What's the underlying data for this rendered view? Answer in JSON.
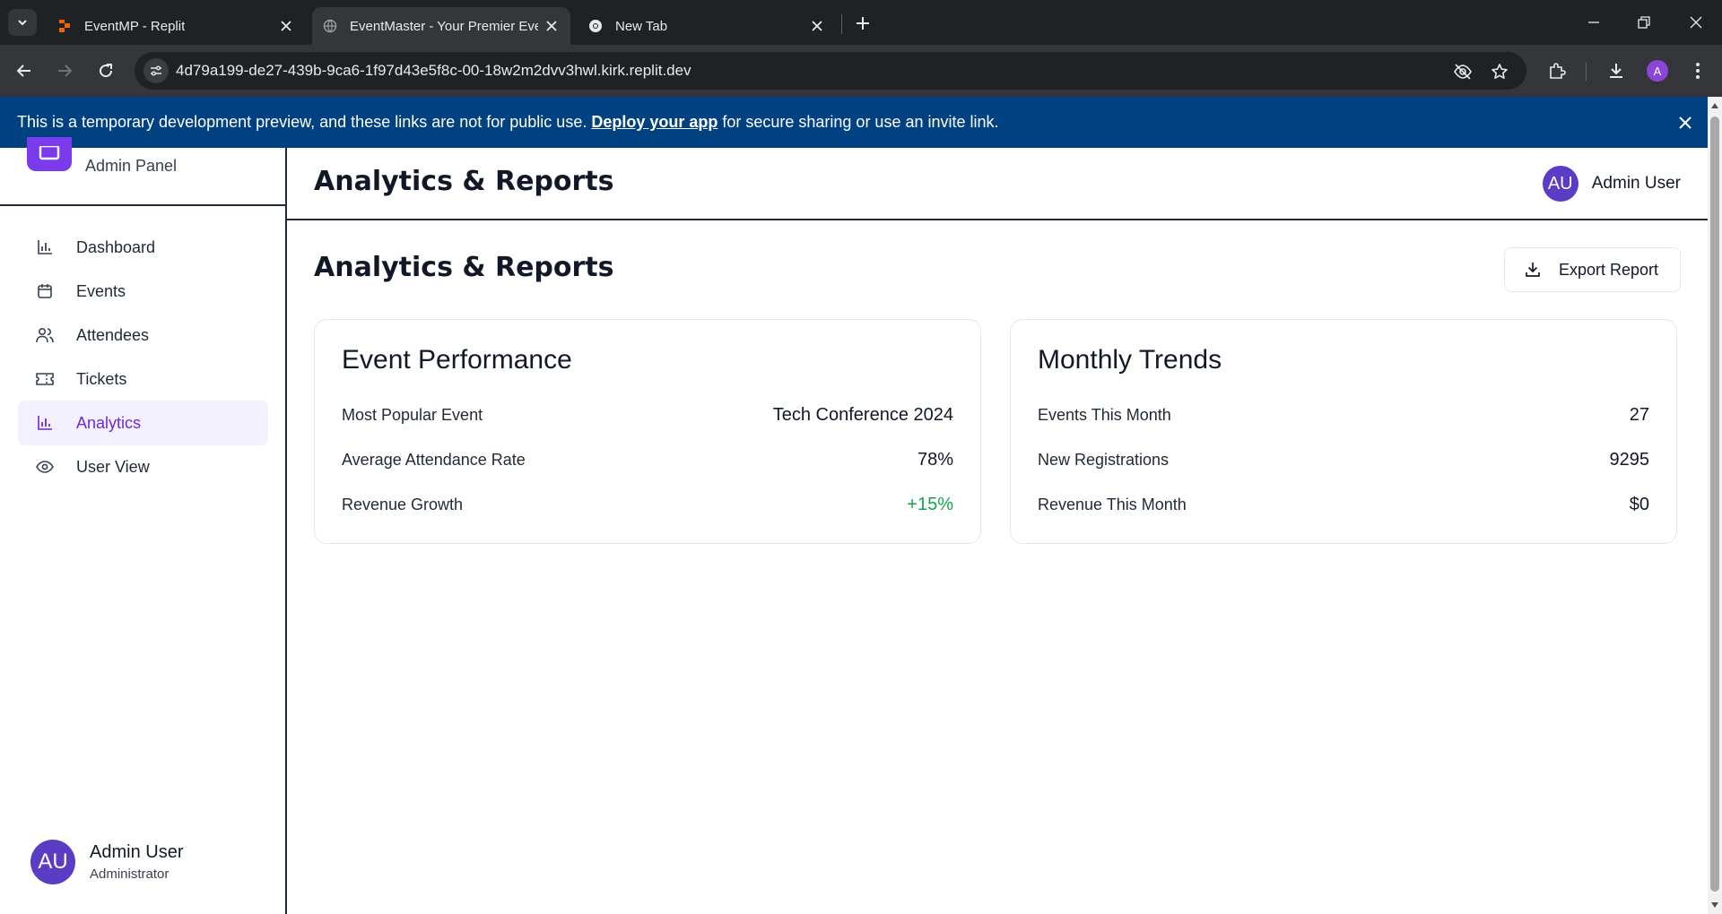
{
  "browser": {
    "tabs": [
      {
        "title": "EventMP - Replit",
        "active": false
      },
      {
        "title": "EventMaster - Your Premier Eve",
        "active": true
      },
      {
        "title": "New Tab",
        "active": false
      }
    ],
    "url": "4d79a199-de27-439b-9ca6-1f97d43e5f8c-00-18w2m2dvv3hwl.kirk.replit.dev",
    "profile_initial": "A"
  },
  "banner": {
    "text_before": "This is a temporary development preview, and these links are not for public use.",
    "link": "Deploy your app",
    "text_after": "for secure sharing or use an invite link."
  },
  "sidebar": {
    "subtitle": "Admin Panel",
    "items": [
      {
        "label": "Dashboard",
        "icon": "bar-chart-icon"
      },
      {
        "label": "Events",
        "icon": "calendar-icon"
      },
      {
        "label": "Attendees",
        "icon": "users-icon"
      },
      {
        "label": "Tickets",
        "icon": "ticket-icon"
      },
      {
        "label": "Analytics",
        "icon": "bar-chart-icon",
        "active": true
      },
      {
        "label": "User View",
        "icon": "eye-icon"
      }
    ],
    "user": {
      "initials": "AU",
      "name": "Admin User",
      "role": "Administrator"
    }
  },
  "header": {
    "title": "Analytics & Reports",
    "user": {
      "initials": "AU",
      "name": "Admin User"
    }
  },
  "main": {
    "page_title": "Analytics & Reports",
    "export_label": "Export Report",
    "cards": [
      {
        "title": "Event Performance",
        "rows": [
          {
            "label": "Most Popular Event",
            "value": "Tech Conference 2024"
          },
          {
            "label": "Average Attendance Rate",
            "value": "78%"
          },
          {
            "label": "Revenue Growth",
            "value": "+15%"
          }
        ]
      },
      {
        "title": "Monthly Trends",
        "rows": [
          {
            "label": "Events This Month",
            "value": "27"
          },
          {
            "label": "New Registrations",
            "value": "9295"
          },
          {
            "label": "Revenue This Month",
            "value": "$0"
          }
        ]
      }
    ]
  },
  "colors": {
    "accent": "#7c3aed",
    "banner_bg": "#004182",
    "positive": "#16a34a",
    "avatar": "#5b3cc4"
  }
}
